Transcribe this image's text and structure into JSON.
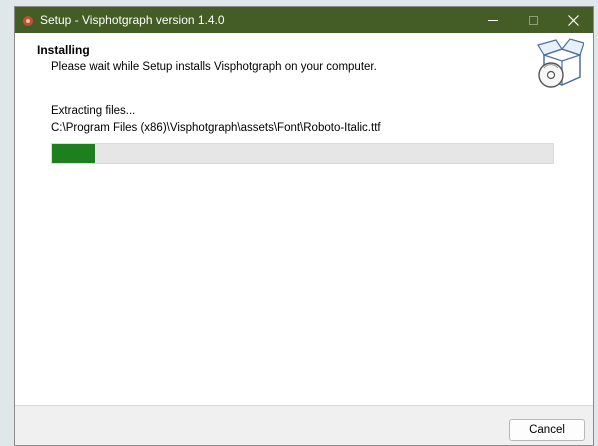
{
  "window": {
    "title": "Setup - Visphotgraph version 1.4.0",
    "app_icon": "setup-app-icon",
    "titlebar_color": "#445c26",
    "controls": {
      "minimize_icon": "minimize-icon",
      "maximize_icon": "maximize-icon",
      "close_icon": "close-icon"
    }
  },
  "header": {
    "title": "Installing",
    "subtitle": "Please wait while Setup installs Visphotgraph on your computer.",
    "graphic_icon": "install-box-icon"
  },
  "progress": {
    "status": "Extracting files...",
    "current_file": "C:\\Program Files (x86)\\Visphotgraph\\assets\\Font\\Roboto-Italic.ttf",
    "fraction": 0.085,
    "fill_color": "#1d7f1d"
  },
  "footer": {
    "cancel_label": "Cancel"
  }
}
